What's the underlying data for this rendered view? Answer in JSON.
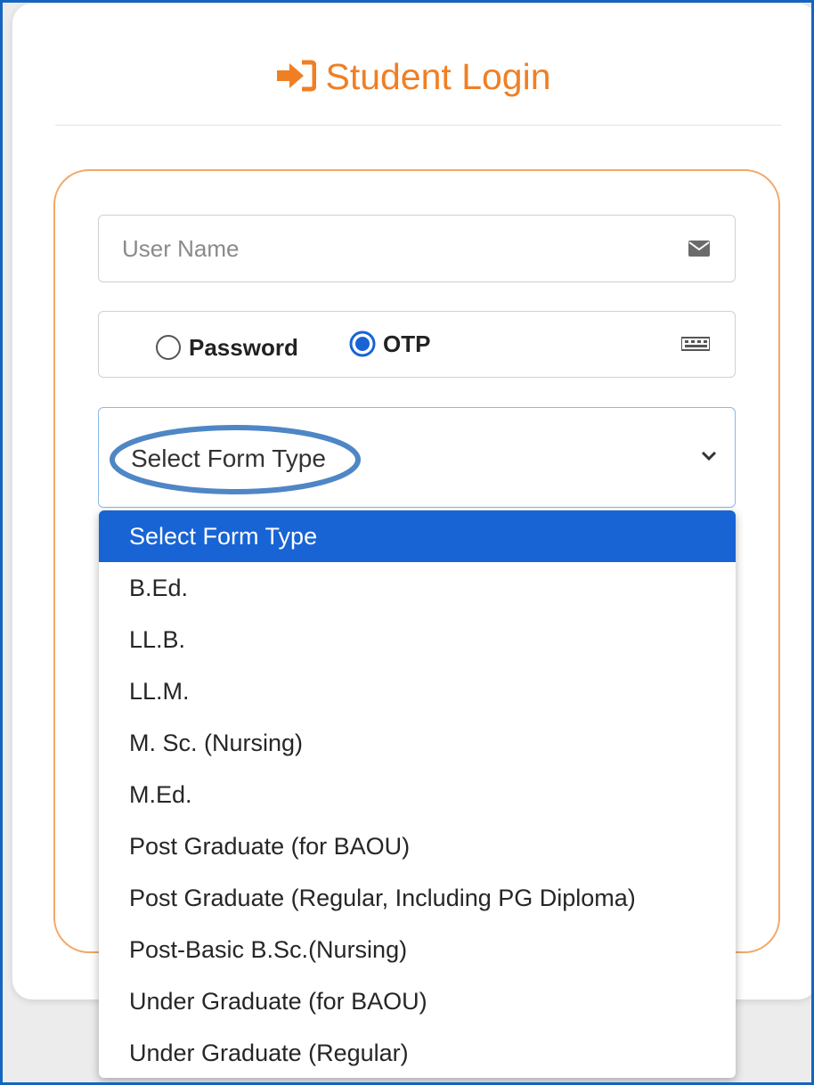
{
  "header": {
    "title": "Student Login",
    "icon": "sign-in-arrow-icon",
    "color": "#f07f24"
  },
  "form": {
    "username": {
      "placeholder": "User Name",
      "icon": "envelope-icon"
    },
    "auth_method": {
      "options": [
        {
          "label": "Password",
          "selected": false
        },
        {
          "label": "OTP",
          "selected": true
        }
      ],
      "icon": "keypad-icon"
    },
    "form_type": {
      "selected_value": "Select Form Type",
      "options": [
        "Select Form Type",
        "B.Ed.",
        "LL.B.",
        "LL.M.",
        "M. Sc. (Nursing)",
        "M.Ed.",
        "Post Graduate (for BAOU)",
        "Post Graduate (Regular, Including PG Diploma)",
        "Post-Basic B.Sc.(Nursing)",
        "Under Graduate (for BAOU)",
        "Under Graduate (Regular)"
      ],
      "highlighted_option": "Select Form Type"
    }
  },
  "colors": {
    "accent": "#f07f24",
    "selection": "#1864d4",
    "annotation": "#4f86c6",
    "frame": "#1565c0"
  }
}
